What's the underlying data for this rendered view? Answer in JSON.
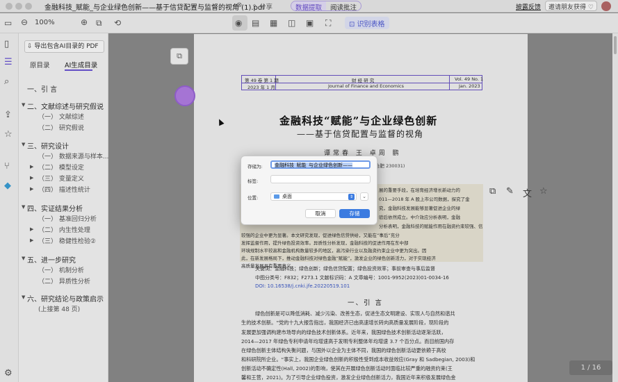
{
  "titlebar": {
    "doc_title": "金融科技_赋能_与企业绿色创新——基于信贷配置与监督的视角 (1).pdf",
    "close": "⊗",
    "share_label": "⇪ 分享",
    "mode_tabs": [
      "数据提取",
      "阅读批注"
    ],
    "feedback_label": "披露反馈",
    "invite_label": "邀请朋友获得 ♡"
  },
  "toolbar": {
    "zoom_value": "100%",
    "identify_table_label": "识别表格"
  },
  "panel": {
    "export_label": "导出包含AI目录的 PDF",
    "tabs": [
      "原目录",
      "AI生成目录"
    ],
    "outline": [
      {
        "label": "一、引 言",
        "level": 1
      },
      {
        "label": "二、文献综述与研究假说",
        "level": 1
      },
      {
        "label": "（一） 文献综述",
        "level": 2
      },
      {
        "label": "（二） 研究假说",
        "level": 2
      },
      {
        "label": "三、研究设计",
        "level": 1
      },
      {
        "label": "（一） 数据来源与样本...",
        "level": 2
      },
      {
        "label": "（二） 模型设定",
        "level": 2
      },
      {
        "label": "（三） 变量定义",
        "level": 2
      },
      {
        "label": "（四） 描述性统计",
        "level": 2
      },
      {
        "label": "四、实证结果分析",
        "level": 1
      },
      {
        "label": "（一） 基准回归分析",
        "level": 2
      },
      {
        "label": "（二） 内生性处理",
        "level": 2
      },
      {
        "label": "（三） 稳健性检验②",
        "level": 2
      },
      {
        "label": "五、进一步研究",
        "level": 1
      },
      {
        "label": "（一） 机制分析",
        "level": 2
      },
      {
        "label": "（二） 异质性分析",
        "level": 2
      },
      {
        "label": "六、研究结论与政策启示",
        "level": 1
      },
      {
        "label": "(上接第 48 页)",
        "level": 2
      }
    ]
  },
  "document": {
    "header_left_top": "第 49 卷  第 1 期",
    "header_left_bottom": "2023 年 1 月",
    "header_mid_top": "财 经 研 究",
    "header_mid_bottom": "Journal of Finance and Economics",
    "header_right_top": "Vol. 49 No. 1",
    "header_right_bottom": "Jan. 2023",
    "title": "金融科技“赋能”与企业绿色创新",
    "subtitle": "——基于信贷配置与监督的视角",
    "authors": "谭常春  王  卓周  鹏",
    "address": "合肥 230031)",
    "abstract_lines": [
      "展的重要手段，在培育经济增长新动力的",
      "011—2018 年 A 股上市公司数据，探究了金",
      "究，金融科技发展能够显著促进企业的绿",
      "验后依然成立。中介效应分析表明，金融",
      "分析表明，金融科技的赋能作用在融资约束较强、信息",
      "较强的企业中更为显著。本文研究发现，促进绿色信贷供给，又能在“事后”充分",
      "发挥监督作用，提升绿色投资效率。异质性分析发现，金融科技的促进作用在东中部",
      "环境规制水平较高和金融机构数量较多的地区，高污染行业以及融资约束企业中更为突出。因",
      "此，在新发展格局下，推动金融科技对绿色金融“赋能”，激发企业的绿色创新活力，对于实现经济",
      "高质量发展具有重要意义。"
    ],
    "keywords": "关键词：金融科技；绿色创新；绿色信贷配置；绿色投资效率；事前审查与事后监督",
    "classification": "中图分类号：F832；F273.1      文献标识码：A      文章编号：1001-9952(2023)01-0034-16",
    "doi": "DOI: 10.16538/j.cnki.jfe.20220519.101",
    "section_title": "一、引  言",
    "body_lines": [
      "绿色创新是可以降低消耗、减少污染、改善生态，促进生态文明建设、实现人与自然和谐共",
      "生的技术创新。“党的十九大报告指出，我国经济已由高速增长转向高质量发展阶段，现阶段的",
      "发展更加强调构建市场导向的绿色技术创新体系。近年来，我国绿色技术创新活动逐渐活跃，",
      "2014—2017 年绿色专利申请年均增速高于发明专利整体年均增速 3.7 个百分点。而目前国内存",
      "在绿色创新主体结构失衡问题，与国外以企业为主体不同，我国的绿色创新活动更依赖于高校",
      "和科研院所企业。“事实上，我国企业绿色创新的积极性受到成本收益效应(Gray 和 Sadbegian, 2003)和",
      "创新活动不确定性(Hall, 2002)的影响，使其在开展绿色创新活动时面临比较严重的融资约束(王",
      "馨和王营，2021)。为了引导企业绿色投资，激发企业绿色创新活力，我国近年来积极发展绿色金"
    ],
    "page_indicator": "1    /  16"
  },
  "dialog": {
    "save_as_label": "存储为:",
    "save_as_value": "金融科技_赋能_与企业绿色创新——",
    "tags_label": "标签:",
    "tags_value": "",
    "location_label": "位置:",
    "location_value": "桌面",
    "cancel_label": "取消",
    "save_label": "存储"
  }
}
